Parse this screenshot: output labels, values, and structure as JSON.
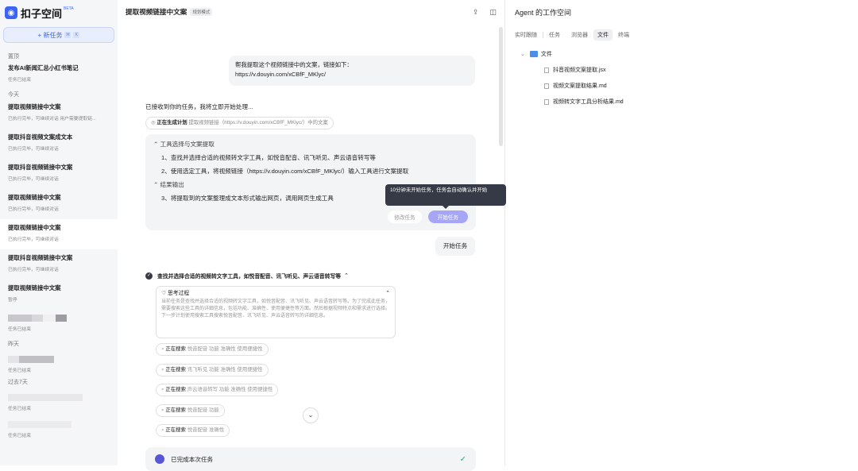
{
  "sidebar": {
    "app_name": "扣子空间",
    "beta": "BETA",
    "new_task": "+ 新任务",
    "sections": {
      "pinned": "置顶",
      "today": "今天",
      "yesterday": "昨天",
      "last7": "过去7天"
    },
    "pinned_items": [
      {
        "title": "发布AI新闻汇总小红书笔记",
        "sub": "任务已结束"
      }
    ],
    "today_items": [
      {
        "title": "提取视频链接中文案",
        "sub": "已执行完毕，可继续对话 用户需要提取链..."
      },
      {
        "title": "提取抖音视频文案成文本",
        "sub": "已执行完毕，可继续对话"
      },
      {
        "title": "提取抖音视频链接中文案",
        "sub": "已执行完毕，可继续对话"
      },
      {
        "title": "提取视频链接中文案",
        "sub": "已执行完毕，可继续对话"
      },
      {
        "title": "提取视频链接中文案",
        "sub": "已执行完毕，可继续对话"
      },
      {
        "title": "提取抖音视频链接中文案",
        "sub": "已执行完毕，可继续对话"
      },
      {
        "title": "提取视频链接中文案",
        "sub": "暂停"
      }
    ],
    "blur_sub_1": "任务已结束",
    "blur_sub_2": "任务已结束",
    "blur_sub_3": "任务已结束",
    "blur_sub_4": "任务已结束"
  },
  "main": {
    "title": "提取视频链接中文案",
    "mode": "规划模式",
    "user_message_l1": "帮我提取这个视频链接中的文案，链接如下：",
    "user_message_l2": "https://v.douyin.com/xCBfF_MKlyc/",
    "ack": "已接收到你的任务，我将立即开始处理...",
    "gen_label": "正在生成计划",
    "gen_detail": "提取视频链接（https://v.douyin.com/xCBfF_MKlyc/）中的文案",
    "plan": {
      "group1": "工具选择与文案提取",
      "step1": "1、查找并选择合适的视频转文字工具，如悦音配音、讯飞听见、声云语音转写等",
      "step2": "2、使用选定工具，将视频链接（https://v.douyin.com/xCBfF_MKlyc/）输入工具进行文案提取",
      "group2": "结果输出",
      "step3": "3、将提取到的文案整理成文本形式输出网页，调用网页生成工具",
      "modify": "修改任务",
      "start": "开始任务"
    },
    "tooltip": "10分钟未开始任务，任务会自动确认并开始",
    "start_bubble": "开始任务",
    "step_head": "查找并选择合适的视频转文字工具，如悦音配音、讯飞听见、声云语音转写等",
    "think_title": "思考过程",
    "think_text": "当前任务是查找并选择合适的视频转文字工具，如悦音配音、讯飞听见、声云语音转写等。为了完成此任务，需要搜索这些工具的详细信息，包括功能、准确性、使用便捷性等方面。然后根据视频特点和需求进行选择。下一步计划使用搜索工具搜索悦音配音、讯飞听见、声云语音转写的详细信息。",
    "searching": "正在搜索",
    "searches": [
      "悦音配音 功能 准确性 使用便捷性",
      "讯飞听见 功能 准确性 使用便捷性",
      "声云语音转写 功能 准确性 使用便捷性",
      "悦音配音 功能",
      "悦音配音 准确性"
    ],
    "done": "已完成本次任务"
  },
  "workspace": {
    "title": "Agent 的工作空间",
    "tabs": [
      "实时跟随",
      "任务",
      "浏览器",
      "文件",
      "终端"
    ],
    "folder": "文件",
    "files": [
      "抖音视频文案提取.jsx",
      "视频文案提取结果.md",
      "视频转文字工具分析结果.md"
    ]
  }
}
